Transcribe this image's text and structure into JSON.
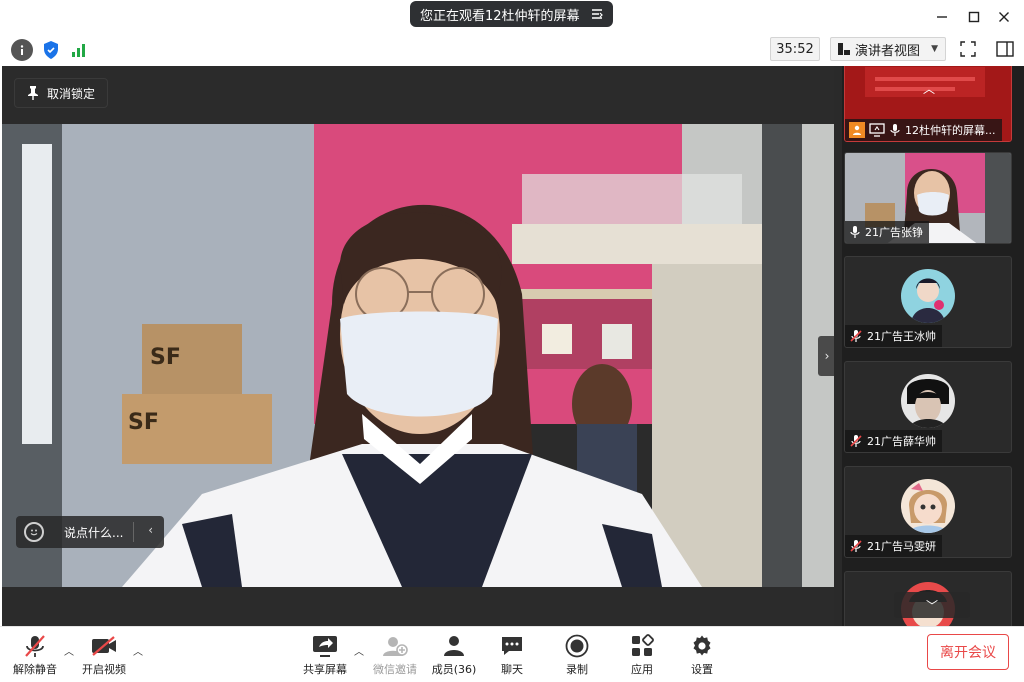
{
  "title_bar": {
    "share_notice": "您正在观看12杜仲轩的屏幕"
  },
  "toolbar": {
    "timer": "35:52",
    "view_mode": "演讲者视图"
  },
  "main": {
    "unpin_label": "取消锁定",
    "chat_placeholder": "说点什么..."
  },
  "sidebar": {
    "participants": [
      {
        "name": "12杜仲轩的屏幕...",
        "mic": "on"
      },
      {
        "name": "21广告张铮",
        "mic": "on"
      },
      {
        "name": "21广告王冰帅",
        "mic": "muted"
      },
      {
        "name": "21广告薛华帅",
        "mic": "muted"
      },
      {
        "name": "21广告马雯妍",
        "mic": "muted"
      }
    ]
  },
  "bottom_bar": {
    "unmute": "解除静音",
    "start_video": "开启视频",
    "share_screen": "共享屏幕",
    "wechat_invite": "微信邀请",
    "members": "成员(36)",
    "chat": "聊天",
    "record": "录制",
    "apps": "应用",
    "settings": "设置",
    "leave": "离开会议"
  },
  "colors": {
    "accent_red": "#e94848",
    "dark_bg": "#2b2b2b",
    "sidebar_bg": "#1f1f1f"
  }
}
